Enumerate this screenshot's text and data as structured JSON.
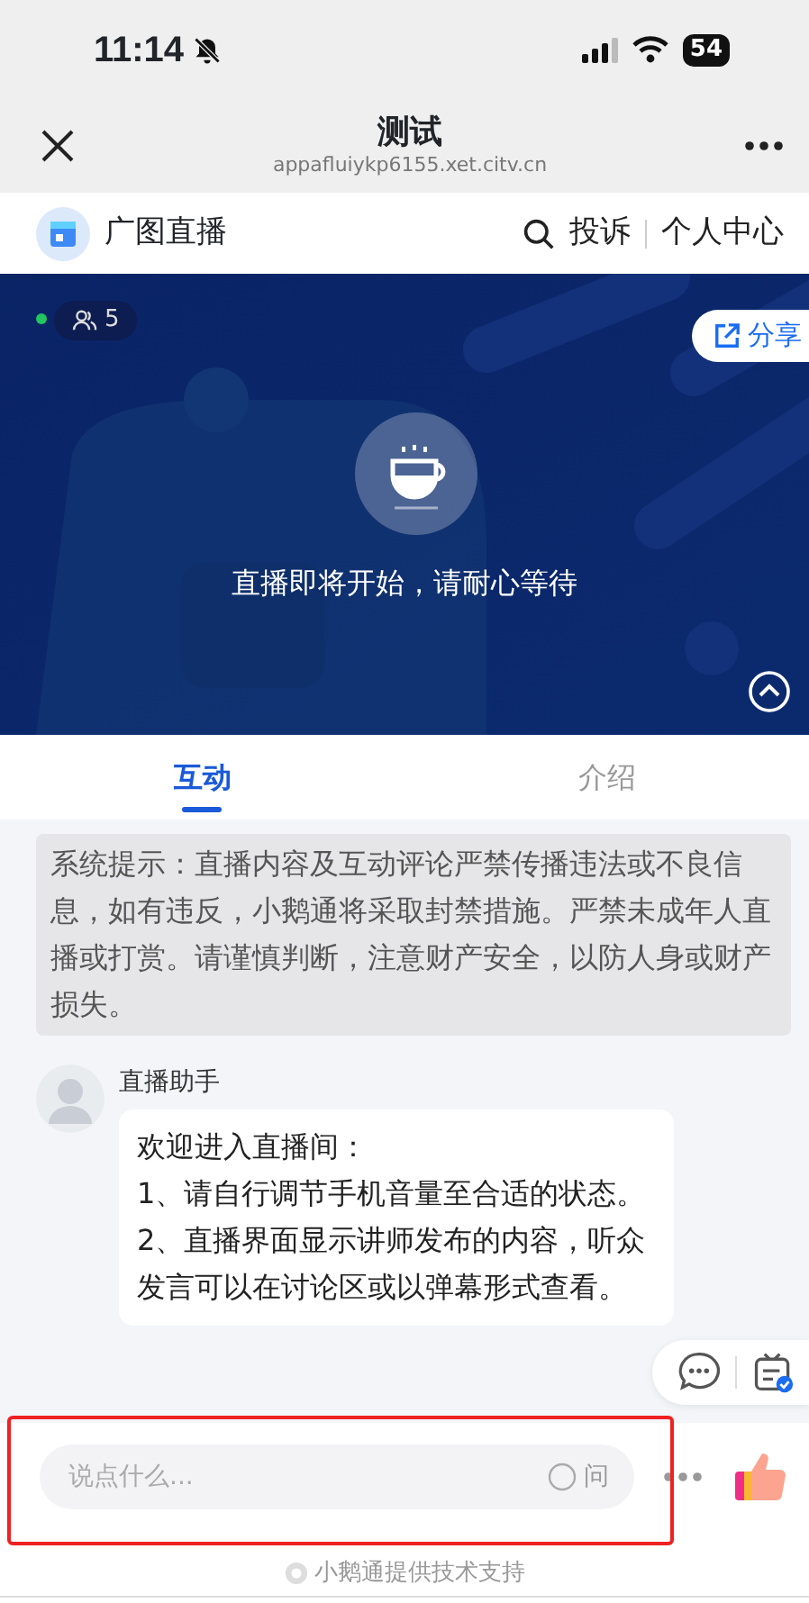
{
  "status_bar": {
    "time": "11:14",
    "battery": "54"
  },
  "browser": {
    "title": "测试",
    "url": "appafluiykp6155.xet.citv.cn"
  },
  "site": {
    "name": "广图直播",
    "links": [
      "投诉",
      "个人中心"
    ]
  },
  "video": {
    "viewers": "5",
    "share": "分享",
    "message": "直播即将开始，请耐心等待"
  },
  "tabs": [
    {
      "label": "互动",
      "selected": true
    },
    {
      "label": "介绍",
      "selected": false
    }
  ],
  "notice": "系统提示：直播内容及互动评论严禁传播违法或不良信息，如有违反，小鹅通将采取封禁措施。严禁未成年人直播或打赏。请谨慎判断，注意财产安全，以防人身或财产损失。",
  "messages": [
    {
      "sender": "直播助手",
      "lines": [
        "欢迎进入直播间：",
        "1、请自行调节手机音量至合适的状态。",
        "2、直播界面显示讲师发布的内容，听众发言可以在讨论区或以弹幕形式查看。"
      ]
    }
  ],
  "composer": {
    "placeholder": "说点什么...",
    "ask": "问",
    "ask_checked": false
  },
  "footer": "小鹅通提供技术支持"
}
